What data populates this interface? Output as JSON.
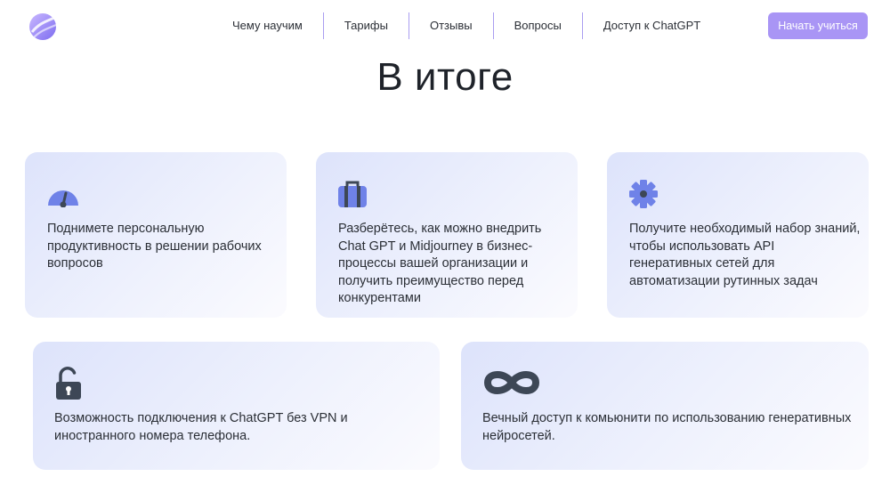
{
  "header": {
    "logo_icon": "gradient-orb-logo",
    "nav": [
      {
        "label": "Чему научим"
      },
      {
        "label": "Тарифы"
      },
      {
        "label": "Отзывы"
      },
      {
        "label": "Вопросы"
      },
      {
        "label": "Доступ к ChatGPT"
      }
    ],
    "cta_label": "Начать учиться"
  },
  "section": {
    "title": "В итоге",
    "cards": [
      {
        "icon": "speedometer-icon",
        "text": "Поднимете персональную продуктивность в решении рабочих вопросов"
      },
      {
        "icon": "briefcase-icon",
        "text": "Разберётесь, как можно внедрить Chat GPT и Midjourney в бизнес-процессы вашей организации и получить преимущество перед конкурентами"
      },
      {
        "icon": "gear-icon",
        "text": "Получите необходимый набор знаний, чтобы использовать API генеративных сетей для автоматизации рутинных задач"
      },
      {
        "icon": "unlocked-padlock-icon",
        "text": "Возможность подключения к ChatGPT без VPN и иностранного номера телефона."
      },
      {
        "icon": "infinity-icon",
        "text": "Вечный доступ к комьюнити по использованию генеративных нейросетей."
      }
    ]
  },
  "colors": {
    "accent": "#a995f5",
    "nav_separator": "#a99df0",
    "icon_blue": "#6f82e8",
    "icon_dark": "#3d4756",
    "card_gradient_start": "#dde3fb",
    "text": "#2b2f36"
  }
}
